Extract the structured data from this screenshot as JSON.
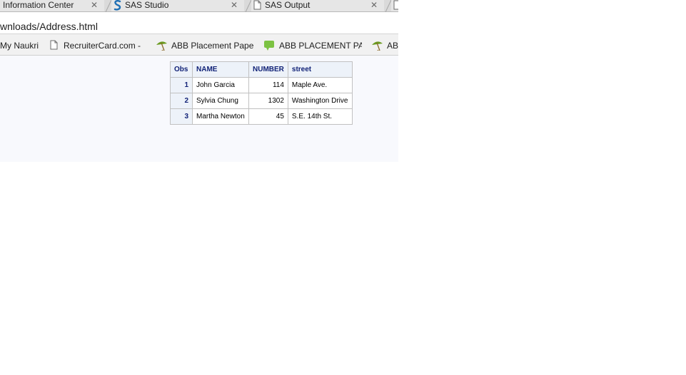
{
  "tabs": [
    {
      "title": "Information Center",
      "close": "✕",
      "icon": "none"
    },
    {
      "title": "SAS Studio",
      "close": "✕",
      "icon": "sas-logo-icon"
    },
    {
      "title": "SAS Output",
      "close": "✕",
      "icon": "document-icon"
    }
  ],
  "address": {
    "url": "wnloads/Address.html"
  },
  "bookmarks": [
    {
      "label": "My Naukri",
      "icon": "none"
    },
    {
      "label": "RecruiterCard.com -",
      "icon": "document-icon"
    },
    {
      "label": "ABB Placement Pape",
      "icon": "umbrella-icon"
    },
    {
      "label": "ABB PLACEMENT PA",
      "icon": "speech-bubble-icon"
    },
    {
      "label": "AB",
      "icon": "umbrella-icon"
    }
  ],
  "table": {
    "headers": [
      "Obs",
      "NAME",
      "NUMBER",
      "street"
    ],
    "rows": [
      {
        "obs": "1",
        "name": "John Garcia",
        "number": "114",
        "street": "Maple Ave."
      },
      {
        "obs": "2",
        "name": "Sylvia Chung",
        "number": "1302",
        "street": "Washington Drive"
      },
      {
        "obs": "3",
        "name": "Martha Newton",
        "number": "45",
        "street": "S.E. 14th St."
      }
    ]
  },
  "colors": {
    "header_text": "#112277",
    "header_bg": "#edf2f9",
    "page_bg": "#f8f9fd",
    "sas_logo": "#1f6fb4",
    "umbrella_green": "#6a9a1f",
    "bubble_green": "#7cc242"
  }
}
